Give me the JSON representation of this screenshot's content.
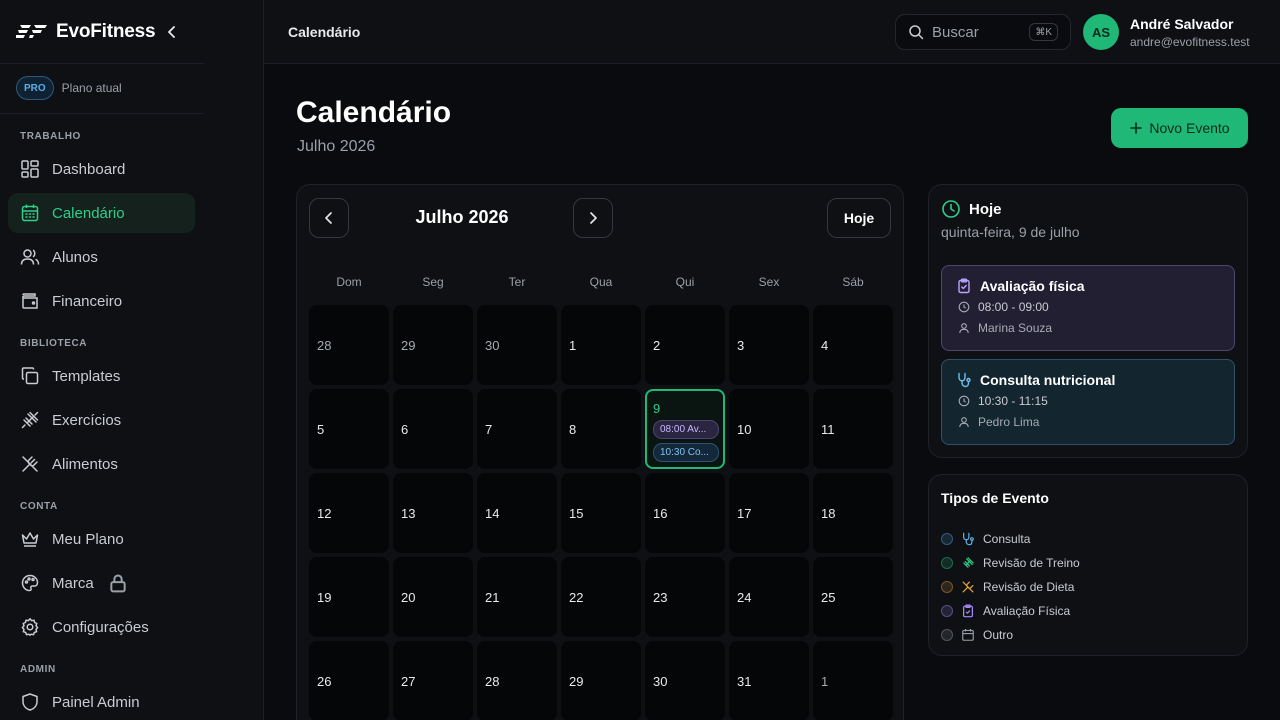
{
  "app": {
    "name": "EvoFitness",
    "plan_badge": "PRO",
    "plan_label": "Plano atual"
  },
  "sidebar": {
    "sections": [
      {
        "title": "TRABALHO"
      },
      {
        "title": "BIBLIOTECA"
      },
      {
        "title": "CONTA"
      },
      {
        "title": "ADMIN"
      }
    ],
    "items": [
      {
        "label": "Dashboard",
        "icon": "dashboard-icon"
      },
      {
        "label": "Calendário",
        "icon": "calendar-icon",
        "active": true
      },
      {
        "label": "Alunos",
        "icon": "users-icon"
      },
      {
        "label": "Financeiro",
        "icon": "wallet-icon"
      },
      {
        "label": "Templates",
        "icon": "copy-icon"
      },
      {
        "label": "Exercícios",
        "icon": "dumbbell-icon"
      },
      {
        "label": "Alimentos",
        "icon": "utensils-icon"
      },
      {
        "label": "Meu Plano",
        "icon": "crown-icon"
      },
      {
        "label": "Marca",
        "icon": "palette-icon",
        "locked": true
      },
      {
        "label": "Configurações",
        "icon": "gear-icon"
      },
      {
        "label": "Painel Admin",
        "icon": "shield-icon"
      }
    ]
  },
  "topbar": {
    "breadcrumb": "Calendário",
    "search_placeholder": "Buscar",
    "search_shortcut": "⌘K",
    "user": {
      "initials": "AS",
      "name": "André Salvador",
      "email": "andre@evofitness.test"
    }
  },
  "page": {
    "title": "Calendário",
    "subtitle": "Julho 2026",
    "new_event_label": "Novo Evento"
  },
  "calendar": {
    "month_label": "Julho 2026",
    "today_label": "Hoje",
    "weekdays": [
      "Dom",
      "Seg",
      "Ter",
      "Qua",
      "Qui",
      "Sex",
      "Sáb"
    ],
    "days": [
      {
        "d": "28",
        "other": true
      },
      {
        "d": "29",
        "other": true
      },
      {
        "d": "30",
        "other": true
      },
      {
        "d": "1"
      },
      {
        "d": "2"
      },
      {
        "d": "3"
      },
      {
        "d": "4"
      },
      {
        "d": "5"
      },
      {
        "d": "6"
      },
      {
        "d": "7"
      },
      {
        "d": "8"
      },
      {
        "d": "9",
        "today": true,
        "events": [
          {
            "label": "08:00 Av...",
            "color": "purple"
          },
          {
            "label": "10:30 Co...",
            "color": "blue"
          }
        ]
      },
      {
        "d": "10"
      },
      {
        "d": "11"
      },
      {
        "d": "12"
      },
      {
        "d": "13"
      },
      {
        "d": "14"
      },
      {
        "d": "15"
      },
      {
        "d": "16"
      },
      {
        "d": "17"
      },
      {
        "d": "18"
      },
      {
        "d": "19"
      },
      {
        "d": "20"
      },
      {
        "d": "21"
      },
      {
        "d": "22"
      },
      {
        "d": "23"
      },
      {
        "d": "24"
      },
      {
        "d": "25"
      },
      {
        "d": "26"
      },
      {
        "d": "27"
      },
      {
        "d": "28"
      },
      {
        "d": "29"
      },
      {
        "d": "30"
      },
      {
        "d": "31"
      },
      {
        "d": "1",
        "other": true
      }
    ]
  },
  "today_panel": {
    "title": "Hoje",
    "date": "quinta-feira, 9 de julho",
    "events": [
      {
        "title": "Avaliação física",
        "time": "08:00 - 09:00",
        "person": "Marina Souza",
        "icon": "clipboard-icon",
        "color": "purple"
      },
      {
        "title": "Consulta nutricional",
        "time": "10:30 - 11:15",
        "person": "Pedro Lima",
        "icon": "stethoscope-icon",
        "color": "blue"
      }
    ]
  },
  "event_types": {
    "title": "Tipos de Evento",
    "items": [
      {
        "label": "Consulta",
        "icon": "stethoscope-icon",
        "color": "#5ab0e8"
      },
      {
        "label": "Revisão de Treino",
        "icon": "dumbbell-icon",
        "color": "#2ecf8a"
      },
      {
        "label": "Revisão de Dieta",
        "icon": "utensils-icon",
        "color": "#e8a23a"
      },
      {
        "label": "Avaliação Física",
        "icon": "clipboard-icon",
        "color": "#a78bfa"
      },
      {
        "label": "Outro",
        "icon": "calendar-icon",
        "color": "#9aa0a8"
      }
    ]
  },
  "colors": {
    "accent": "#1fb877",
    "background": "#0a0b0e",
    "panel": "#0e1014"
  }
}
